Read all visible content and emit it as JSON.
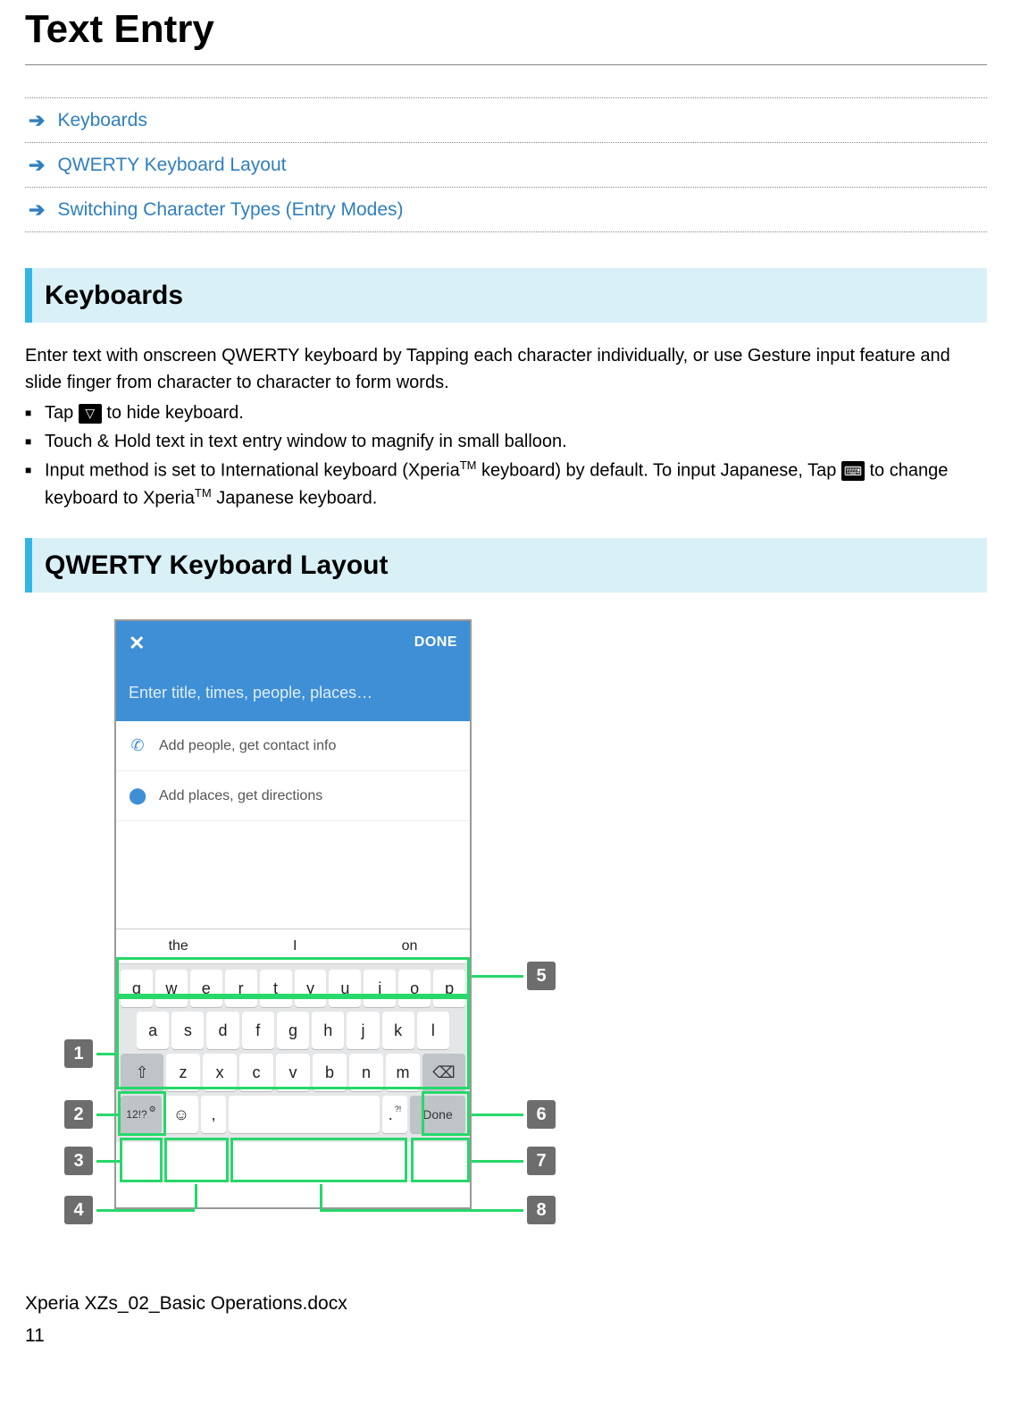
{
  "page": {
    "title": "Text Entry",
    "footer_filename": "Xperia XZs_02_Basic Operations.docx",
    "page_number": "11"
  },
  "toc": {
    "item1": "Keyboards",
    "item2": "QWERTY Keyboard Layout",
    "item3": "Switching Character Types (Entry Modes)"
  },
  "section1": {
    "title": "Keyboards",
    "intro": "Enter text with onscreen QWERTY keyboard by Tapping each character individually, or use Gesture input feature and slide finger from character to character to form words.",
    "b1_a": "Tap ",
    "b1_b": " to hide keyboard.",
    "b2": "Touch & Hold text in text entry window to magnify in small balloon.",
    "b3_a": "Input method is set to International keyboard (Xperia",
    "b3_tm": "TM",
    "b3_b": " keyboard) by default. To input Japanese, Tap ",
    "b3_c": " to change keyboard to Xperia",
    "b3_d": " Japanese keyboard."
  },
  "section2": {
    "title": "QWERTY Keyboard Layout"
  },
  "mock": {
    "close": "✕",
    "done": "DONE",
    "title_placeholder": "Enter title, times, people, places…",
    "row_people": "Add people, get contact info",
    "row_places": "Add places, get directions",
    "suggestions": {
      "s1": "the",
      "s2": "I",
      "s3": "on"
    },
    "keys_row1": {
      "k1": "q",
      "k2": "w",
      "k3": "e",
      "k4": "r",
      "k5": "t",
      "k6": "y",
      "k7": "u",
      "k8": "i",
      "k9": "o",
      "k10": "p"
    },
    "keys_row2": {
      "k1": "a",
      "k2": "s",
      "k3": "d",
      "k4": "f",
      "k5": "g",
      "k6": "h",
      "k7": "j",
      "k8": "k",
      "k9": "l"
    },
    "keys_row3": {
      "shift": "⇧",
      "k1": "z",
      "k2": "x",
      "k3": "c",
      "k4": "v",
      "k5": "b",
      "k6": "n",
      "k7": "m",
      "back": "⌫"
    },
    "keys_row4": {
      "mode": "12!?",
      "emoji": "☺",
      "comma": ",",
      "period": ".",
      "enter": "Done"
    }
  },
  "callouts": {
    "c1": "1",
    "c2": "2",
    "c3": "3",
    "c4": "4",
    "c5": "5",
    "c6": "6",
    "c7": "7",
    "c8": "8"
  }
}
